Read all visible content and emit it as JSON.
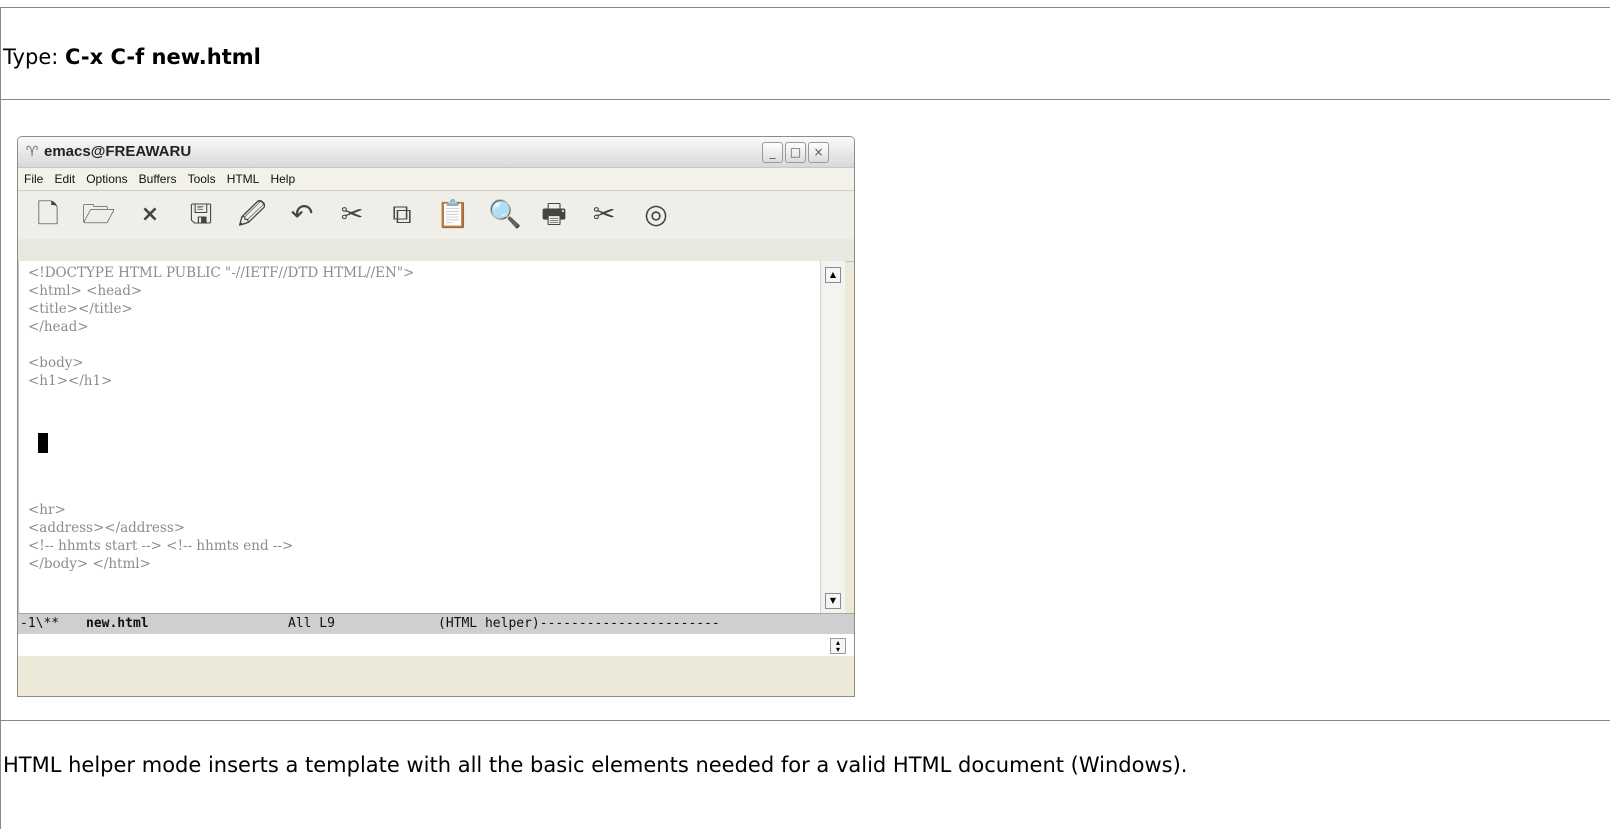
{
  "instruction": {
    "prefix": "Type: ",
    "keys": "C-x C-f new.html"
  },
  "emacs": {
    "window_title": "emacs@FREAWARU",
    "title_controls": {
      "minimize": "_",
      "maximize": "□",
      "close": "×"
    },
    "menu": [
      "File",
      "Edit",
      "Options",
      "Buffers",
      "Tools",
      "HTML",
      "Help"
    ],
    "toolbar_icons": [
      "new-file-icon",
      "open-folder-icon",
      "close-buffer-icon",
      "save-icon",
      "save-as-icon",
      "undo-icon",
      "cut-icon",
      "copy-icon",
      "paste-icon",
      "search-icon",
      "print-icon",
      "preferences-icon",
      "help-icon"
    ],
    "toolbar_glyphs": [
      "🗋",
      "🗁",
      "×",
      "🖫",
      "🖉",
      "↶",
      "✂",
      "⧉",
      "📋",
      "🔍",
      "🖶",
      "✂",
      "◎"
    ],
    "buffer_lines": [
      "<!DOCTYPE HTML PUBLIC \"-//IETF//DTD HTML//EN\">",
      "<html> <head>",
      "<title></title>",
      "</head>",
      "",
      "<body>",
      "<h1></h1>",
      "",
      "",
      "",
      "<hr>",
      "<address></address>",
      "<!-- hhmts start --> <!-- hhmts end -->",
      "</body> </html>"
    ],
    "mode_line": {
      "status": "-1\\**",
      "buffer_name": "new.html",
      "position": "All L9",
      "mode": "(HTML helper)-----------------------"
    }
  },
  "caption": "HTML helper mode inserts a template with all the basic elements needed for a valid HTML document (Windows)."
}
